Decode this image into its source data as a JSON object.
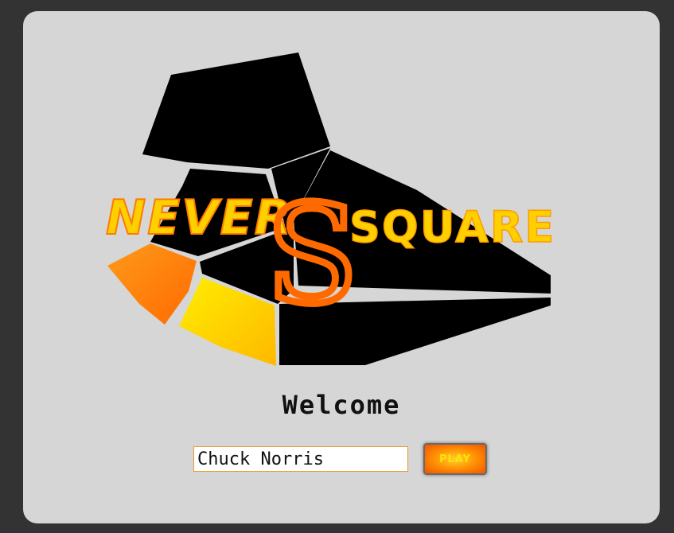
{
  "logo": {
    "text_never": "NEVER",
    "text_square": "SQUARE",
    "colors": {
      "orange": "#ff7a00",
      "yellow": "#ffe400",
      "black": "#000000"
    }
  },
  "welcome": {
    "title": "Welcome"
  },
  "login": {
    "name_value": "Chuck Norris",
    "play_label": "PLAY"
  }
}
